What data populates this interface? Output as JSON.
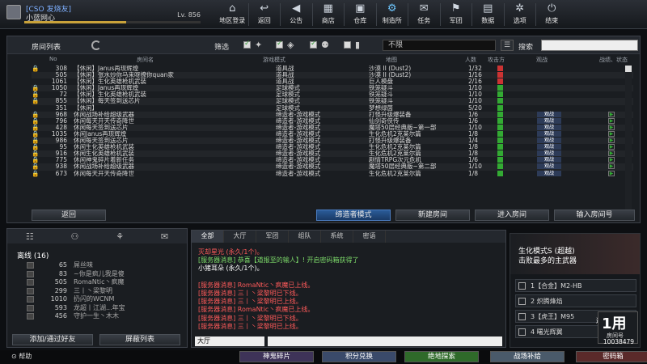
{
  "player": {
    "tag": "[CSO 发烧友]",
    "name": "小蓝网心",
    "level": "Lv. 856",
    "xp_fraction": 0.58
  },
  "nav": [
    {
      "label": "地区登录",
      "icon": "globe-icon",
      "glyph": "⌂"
    },
    {
      "label": "返回",
      "icon": "back-icon",
      "glyph": "↩"
    },
    {
      "label": "公告",
      "icon": "speaker-icon",
      "glyph": "◀"
    },
    {
      "label": "商店",
      "icon": "shop-icon",
      "glyph": "▦"
    },
    {
      "label": "仓库",
      "icon": "warehouse-icon",
      "glyph": "▣"
    },
    {
      "label": "制造所",
      "icon": "factory-icon",
      "glyph": "⚙"
    },
    {
      "label": "任务",
      "icon": "mission-icon",
      "glyph": "✉"
    },
    {
      "label": "军团",
      "icon": "clan-icon",
      "glyph": "⚑"
    },
    {
      "label": "数据",
      "icon": "stats-icon",
      "glyph": "▤"
    },
    {
      "label": "选项",
      "icon": "gear-icon",
      "glyph": "✲"
    },
    {
      "label": "结束",
      "icon": "power-icon",
      "glyph": "⏻"
    }
  ],
  "roomlist": {
    "title": "房间列表",
    "filter_label": "筛选",
    "filter_select": "不限",
    "search_label": "搜索",
    "headers": {
      "no": "No",
      "name": "房间名",
      "mode": "游戏模式",
      "map": "地图",
      "count": "人数",
      "status": "攻击方",
      "watch": "观战",
      "like": "战绩、状态"
    },
    "rows": [
      {
        "lock": "🔒",
        "no": "308",
        "name": "【休闲】Janus再现辉煌",
        "mode": "道具战",
        "map": "沙漠 II (Dust2)",
        "count": "1/32",
        "watch": "",
        "like": "",
        "st": "#c33"
      },
      {
        "lock": "",
        "no": "505",
        "name": "【休闲】张水炒你马来呀撩你quan家",
        "mode": "道具战",
        "map": "沙漠 II (Dust2)",
        "count": "1/16",
        "watch": "",
        "like": "",
        "st": "#c33"
      },
      {
        "lock": "",
        "no": "1061",
        "name": "【休闲】生化英雄枪机武装",
        "mode": "道具战",
        "map": "巨人模盘",
        "count": "2/16",
        "watch": "",
        "like": "",
        "st": "#c33"
      },
      {
        "lock": "🔒",
        "no": "1050",
        "name": "【休闲】Janus再现辉煌",
        "mode": "足球模式",
        "map": "铁笼疑斗",
        "count": "1/10",
        "watch": "",
        "like": "",
        "st": "#3a3"
      },
      {
        "lock": "🔒",
        "no": "72",
        "name": "【休闲】生化英雄枪机武装",
        "mode": "足球模式",
        "map": "铁笼疑斗",
        "count": "1/10",
        "watch": "",
        "like": "",
        "st": "#3a3"
      },
      {
        "lock": "🔒",
        "no": "855",
        "name": "【休闲】每天签到送芯片",
        "mode": "足球模式",
        "map": "铁笼疑斗",
        "count": "1/10",
        "watch": "",
        "like": "",
        "st": "#3a3"
      },
      {
        "lock": "",
        "no": "351",
        "name": "【休闲】",
        "mode": "足球模式",
        "map": "梦想绿茵",
        "count": "5/20",
        "watch": "",
        "like": "",
        "st": "#3a3"
      },
      {
        "lock": "🔒",
        "no": "968",
        "name": "休闲战场补给超级武器",
        "mode": "缔造者-游戏模式",
        "map": "打怪升级爆装备",
        "count": "1/6",
        "watch": "观战",
        "like": "",
        "st": "#3a3"
      },
      {
        "lock": "🔒",
        "no": "796",
        "name": "休闲每天开天传奇降世",
        "mode": "缔造者-游戏模式",
        "map": "仙剑奇侠传",
        "count": "1/6",
        "watch": "观战",
        "like": "",
        "st": "#3a3"
      },
      {
        "lock": "🔒",
        "no": "428",
        "name": "休闲每天签到送芯片",
        "mode": "缔造者-游戏模式",
        "map": "魔塔50层经典版~第一部",
        "count": "1/10",
        "watch": "观战",
        "like": "",
        "st": "#3a3"
      },
      {
        "lock": "🔒",
        "no": "1035",
        "name": "休闲Janus再现辉煌",
        "mode": "缔造者-游戏模式",
        "map": "生化危机2克莱尔篇",
        "count": "1/8",
        "watch": "观战",
        "like": "",
        "st": "#3a3"
      },
      {
        "lock": "🔒",
        "no": "986",
        "name": "休闲每天签到送芯片",
        "mode": "缔造者-游戏模式",
        "map": "打怪升级爆装备",
        "count": "1/4",
        "watch": "观战",
        "like": "",
        "st": "#3a3"
      },
      {
        "lock": "🔒",
        "no": "95",
        "name": "休闲生化英雄枪机武装",
        "mode": "缔造者-游戏模式",
        "map": "生化危机2克莱尔篇",
        "count": "1/8",
        "watch": "观战",
        "like": "",
        "st": "#3a3"
      },
      {
        "lock": "🔒",
        "no": "916",
        "name": "休闲生化英雄枪机武装",
        "mode": "缔造者-游戏模式",
        "map": "生化危机2克莱尔篇",
        "count": "1/8",
        "watch": "观战",
        "like": "",
        "st": "#3a3"
      },
      {
        "lock": "🔒",
        "no": "775",
        "name": "休闲神鬼碎片着新任务",
        "mode": "缔造者-游戏模式",
        "map": "剧情TRPG次元危机",
        "count": "1/6",
        "watch": "观战",
        "like": "",
        "st": "#3a3"
      },
      {
        "lock": "🔒",
        "no": "938",
        "name": "休闲战场补给超级武器",
        "mode": "缔造者-游戏模式",
        "map": "魔塔50层经典版~第二部",
        "count": "1/10",
        "watch": "观战",
        "like": "",
        "st": "#3a3"
      },
      {
        "lock": "🔒",
        "no": "673",
        "name": "休闲每天开天传奇降世",
        "mode": "缔造者-游戏模式",
        "map": "生化危机2克莱尔篇",
        "count": "1/8",
        "watch": "观战",
        "like": "",
        "st": "#3a3"
      }
    ],
    "btn_back": "返回",
    "btn_creator": "缔造者模式",
    "btn_new": "新建房间",
    "btn_enter": "进入房间",
    "btn_input": "输入房间号"
  },
  "friends": {
    "channel": "离线 (16)",
    "list": [
      {
        "lv": "65",
        "name": "屌丝味"
      },
      {
        "lv": "83",
        "name": "~你是疯儿我是傻"
      },
      {
        "lv": "505",
        "name": "RomaNtic丶疯魔"
      },
      {
        "lv": "299",
        "name": "三丨丶梁黎明"
      },
      {
        "lv": "1010",
        "name": "扔闪的WCNM"
      },
      {
        "lv": "593",
        "name": "龙超丨江湖...年宝"
      },
      {
        "lv": "456",
        "name": "守护一生丶木木"
      }
    ],
    "btn_add": "添加/通过好友",
    "btn_block": "屏蔽列表"
  },
  "chat": {
    "tabs": [
      "全部",
      "大厅",
      "军团",
      "组队",
      "系统",
      "密语"
    ],
    "messages": [
      {
        "text": "灭却星光 (永久/1个)。",
        "color": "#ff5a5a"
      },
      {
        "text": "[服务器消息] 恭喜【道报至的输人】! 开启密码箱获得了",
        "color": "#7ddc6a"
      },
      {
        "text": "小猪耳朵 (永久/1个)。",
        "color": "#ffffff"
      },
      {
        "text": "",
        "color": "#ffffff"
      },
      {
        "text": "[服务器消息] RomaNtic丶疯魔已上线。",
        "color": "#ff5a5a"
      },
      {
        "text": "[服务器消息] 三丨丶梁黎明已下线。",
        "color": "#ff5a5a"
      },
      {
        "text": "[服务器消息] 三丨丶梁黎明已上线。",
        "color": "#ff5a5a"
      },
      {
        "text": "[服务器消息] RomaNtic丶疯魔已上线。",
        "color": "#ff5a5a"
      },
      {
        "text": "[服务器消息] 三丨丶梁黎明已下线。",
        "color": "#ff5a5a"
      },
      {
        "text": "[服务器消息] 三丨丶梁黎明已上线。",
        "color": "#ff5a5a"
      }
    ],
    "channel": "大厅"
  },
  "rightpanel": {
    "banner1": "生化模式S (超越)",
    "banner2": "击败最多的主武器",
    "weapons": [
      {
        "label": "1【合金】M2-HB"
      },
      {
        "label": "2 炽腾烽焰"
      },
      {
        "label": "3【虎王】M95"
      },
      {
        "label": "4 曙光辉翼"
      }
    ],
    "return": "返回",
    "roomno_label": "房间号",
    "roomno": "10038479",
    "big": "1用"
  },
  "bottom": {
    "help": "帮助",
    "btns": [
      "神鬼碎片",
      "积分兑换",
      "绝地探索",
      "战场补给",
      "密码箱"
    ]
  }
}
